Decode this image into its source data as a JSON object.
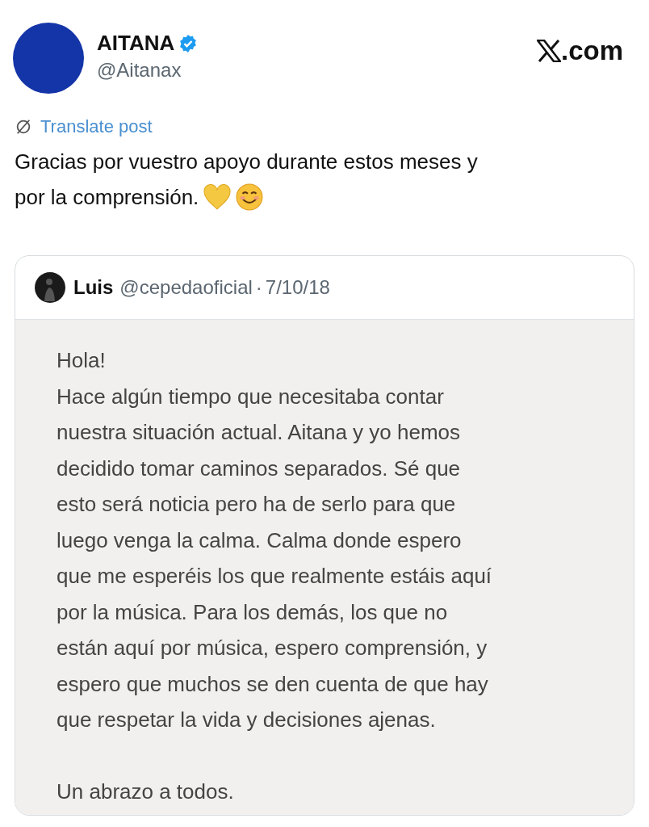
{
  "post": {
    "author": {
      "name": "AITANA",
      "verified": true,
      "handle": "@Aitanax"
    },
    "site": ".com",
    "translate": "Translate post",
    "text_lines": [
      "Gracias por vuestro apoyo durante estos meses y",
      "por la comprensión."
    ],
    "quote": {
      "author": "Luis",
      "handle": "@cepedaoficial",
      "separator": "·",
      "date": "7/10/18",
      "note_paragraphs": [
        [
          "Hola!",
          "Hace algún tiempo que necesitaba contar",
          "nuestra situación actual. Aitana y yo hemos",
          "decidido tomar caminos separados. Sé que",
          "esto será noticia pero ha de serlo para que",
          "luego venga la calma. Calma donde espero",
          "que me esperéis los que realmente estáis aquí",
          "por la música. Para los demás, los que no",
          "están aquí por música, espero comprensión, y",
          "espero que muchos se den cuenta de que hay",
          "que respetar la vida y decisiones ajenas."
        ],
        [
          "Un abrazo a todos."
        ]
      ]
    }
  }
}
